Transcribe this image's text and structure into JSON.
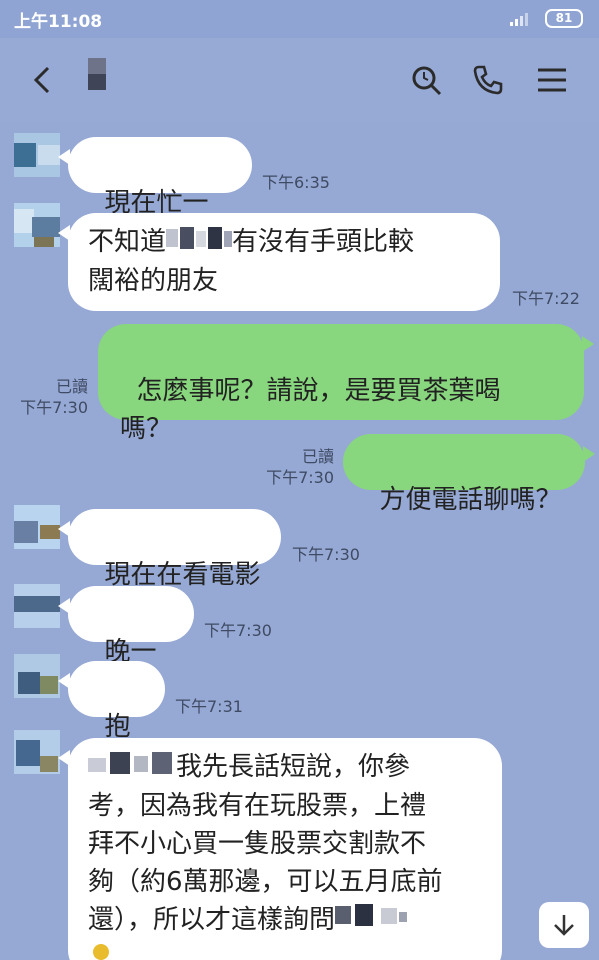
{
  "status_bar": {
    "time": "上午11:08",
    "battery": "81"
  },
  "header": {
    "icons": [
      "back-arrow-icon",
      "search-icon",
      "phone-icon",
      "menu-icon"
    ]
  },
  "messages": [
    {
      "side": "left",
      "text": "現在忙一下",
      "time": "下午6:35"
    },
    {
      "side": "left",
      "text_parts": [
        "不知道",
        "有沒有手頭比較",
        "闊裕的朋友"
      ],
      "time": "下午7:22"
    },
    {
      "side": "right",
      "text": "怎麼事呢？請說，是要買茶葉喝\n嗎？",
      "read": "已讀",
      "time": "下午7:30"
    },
    {
      "side": "right",
      "text": "方便電話聊嗎？",
      "read": "已讀",
      "time": "下午7:30"
    },
    {
      "side": "left",
      "text": "現在在看電影",
      "time": "下午7:30"
    },
    {
      "side": "left",
      "text": "晚一點",
      "time": "下午7:30"
    },
    {
      "side": "left",
      "text": "抱歉",
      "time": "下午7:31"
    },
    {
      "side": "left",
      "text_parts": [
        "我先長話短說，你參",
        "考，因為我有在玩股票，上禮\n拜不小心買一隻股票交割款不\n夠（約6萬那邊，可以五月底前\n還），所以才這樣詢問"
      ]
    }
  ],
  "colors": {
    "background": "#96a9d4",
    "my_bubble": "#88d67d",
    "their_bubble": "#ffffff"
  }
}
